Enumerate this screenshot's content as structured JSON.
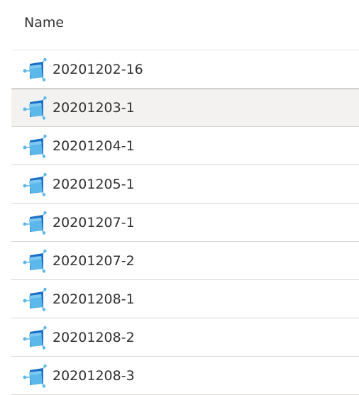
{
  "header": {
    "name_label": "Name"
  },
  "rows": [
    {
      "name": "20201202-16",
      "selected": false
    },
    {
      "name": "20201203-1",
      "selected": true
    },
    {
      "name": "20201204-1",
      "selected": false
    },
    {
      "name": "20201205-1",
      "selected": false
    },
    {
      "name": "20201207-1",
      "selected": false
    },
    {
      "name": "20201207-2",
      "selected": false
    },
    {
      "name": "20201208-1",
      "selected": false
    },
    {
      "name": "20201208-2",
      "selected": false
    },
    {
      "name": "20201208-3",
      "selected": false
    }
  ],
  "icon": "container-icon",
  "colors": {
    "icon_dark": "#1a6fc9",
    "icon_light": "#5cb8ea",
    "selected_bg": "#f3f2f1",
    "divider": "#d9d7d5"
  }
}
